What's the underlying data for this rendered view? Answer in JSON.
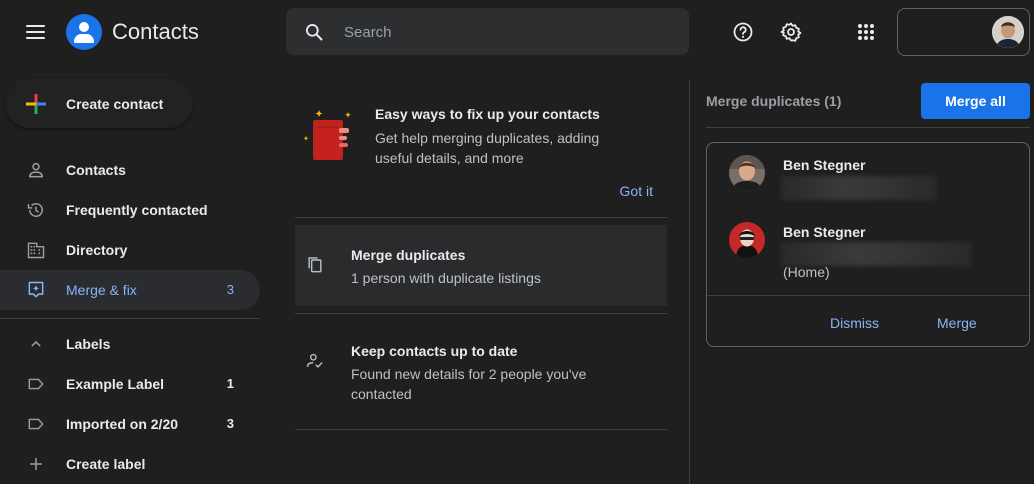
{
  "header": {
    "app_title": "Contacts",
    "search_placeholder": "Search",
    "icons": [
      "menu-icon",
      "contacts-logo-icon",
      "search-icon",
      "help-icon",
      "settings-icon",
      "apps-grid-icon"
    ]
  },
  "sidebar": {
    "create_label": "Create contact",
    "items": [
      {
        "label": "Contacts",
        "icon": "person-icon"
      },
      {
        "label": "Frequently contacted",
        "icon": "history-icon"
      },
      {
        "label": "Directory",
        "icon": "building-icon"
      },
      {
        "label": "Merge & fix",
        "icon": "merge-fix-icon",
        "count": "3",
        "active": true
      }
    ],
    "labels_header": "Labels",
    "labels": [
      {
        "label": "Example Label",
        "count": "1"
      },
      {
        "label": "Imported on 2/20",
        "count": "3"
      }
    ],
    "create_label_item": "Create label"
  },
  "middle": {
    "tip": {
      "title": "Easy ways to fix up your contacts",
      "description": "Get help merging duplicates, adding useful details, and more",
      "action": "Got it"
    },
    "items": [
      {
        "title": "Merge duplicates",
        "description": "1 person with duplicate listings",
        "icon": "copy-icon"
      },
      {
        "title": "Keep contacts up to date",
        "description": "Found new details for 2 people you've contacted",
        "icon": "person-check-icon"
      }
    ]
  },
  "right": {
    "title": "Merge duplicates (1)",
    "merge_all": "Merge all",
    "contacts": [
      {
        "name": "Ben Stegner"
      },
      {
        "name": "Ben Stegner",
        "sub": "(Home)"
      }
    ],
    "dismiss": "Dismiss",
    "merge": "Merge"
  },
  "colors": {
    "background": "#1f1f1f",
    "accent": "#8ab4f8",
    "primary_button": "#1a73e8"
  }
}
